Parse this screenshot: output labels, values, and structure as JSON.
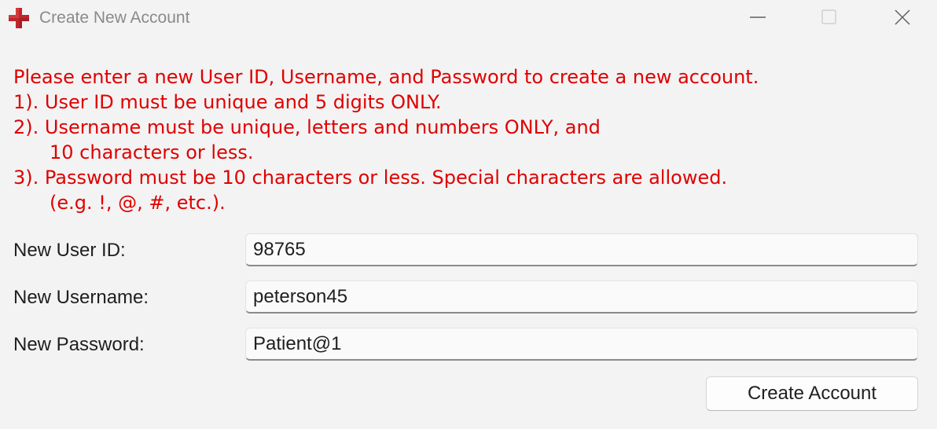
{
  "window": {
    "title": "Create New Account",
    "icon": "red-cross-icon",
    "controls": [
      "minimize-icon",
      "maximize-icon",
      "close-icon"
    ]
  },
  "instructions": {
    "intro": "Please enter a new User ID, Username, and Password to create a new account.",
    "rule1": "1). User ID must be unique and 5 digits ONLY.",
    "rule2_line1": "2). Username must be unique, letters and numbers ONLY, and",
    "rule2_line2": "10 characters or less.",
    "rule3_line1": "3). Password must be 10 characters or less. Special characters are allowed.",
    "rule3_line2": "(e.g. !, @, #, etc.).",
    "color": "#e00000"
  },
  "form": {
    "user_id": {
      "label": "New User ID:",
      "value": "98765"
    },
    "username": {
      "label": "New Username:",
      "value": "peterson45"
    },
    "password": {
      "label": "New Password:",
      "value": "Patient@1"
    }
  },
  "actions": {
    "create_label": "Create Account"
  }
}
